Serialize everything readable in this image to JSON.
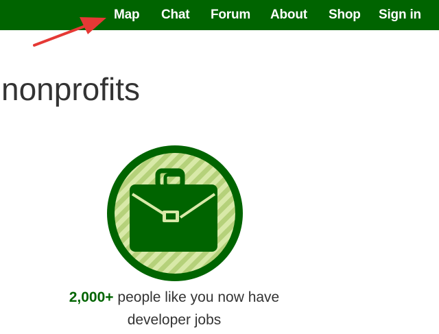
{
  "nav": {
    "items": [
      {
        "id": "map",
        "label": "Map"
      },
      {
        "id": "chat",
        "label": "Chat"
      },
      {
        "id": "forum",
        "label": "Forum"
      },
      {
        "id": "about",
        "label": "About"
      },
      {
        "id": "shop",
        "label": "Shop"
      },
      {
        "id": "signin",
        "label": "Sign in"
      }
    ],
    "background": "#006400",
    "text_color": "#ffffff"
  },
  "annotation": {
    "icon": "red-arrow-icon",
    "color": "#e53935"
  },
  "main": {
    "heading": "nonprofits",
    "badge_icon": "briefcase-icon",
    "badge_colors": {
      "ring": "#006400",
      "stripe_light": "#d8e9a8",
      "stripe_dark": "#b5d17a"
    },
    "stat": {
      "number": "2,000+",
      "text_line1": "people like you now have",
      "text_line2": "developer jobs"
    }
  }
}
